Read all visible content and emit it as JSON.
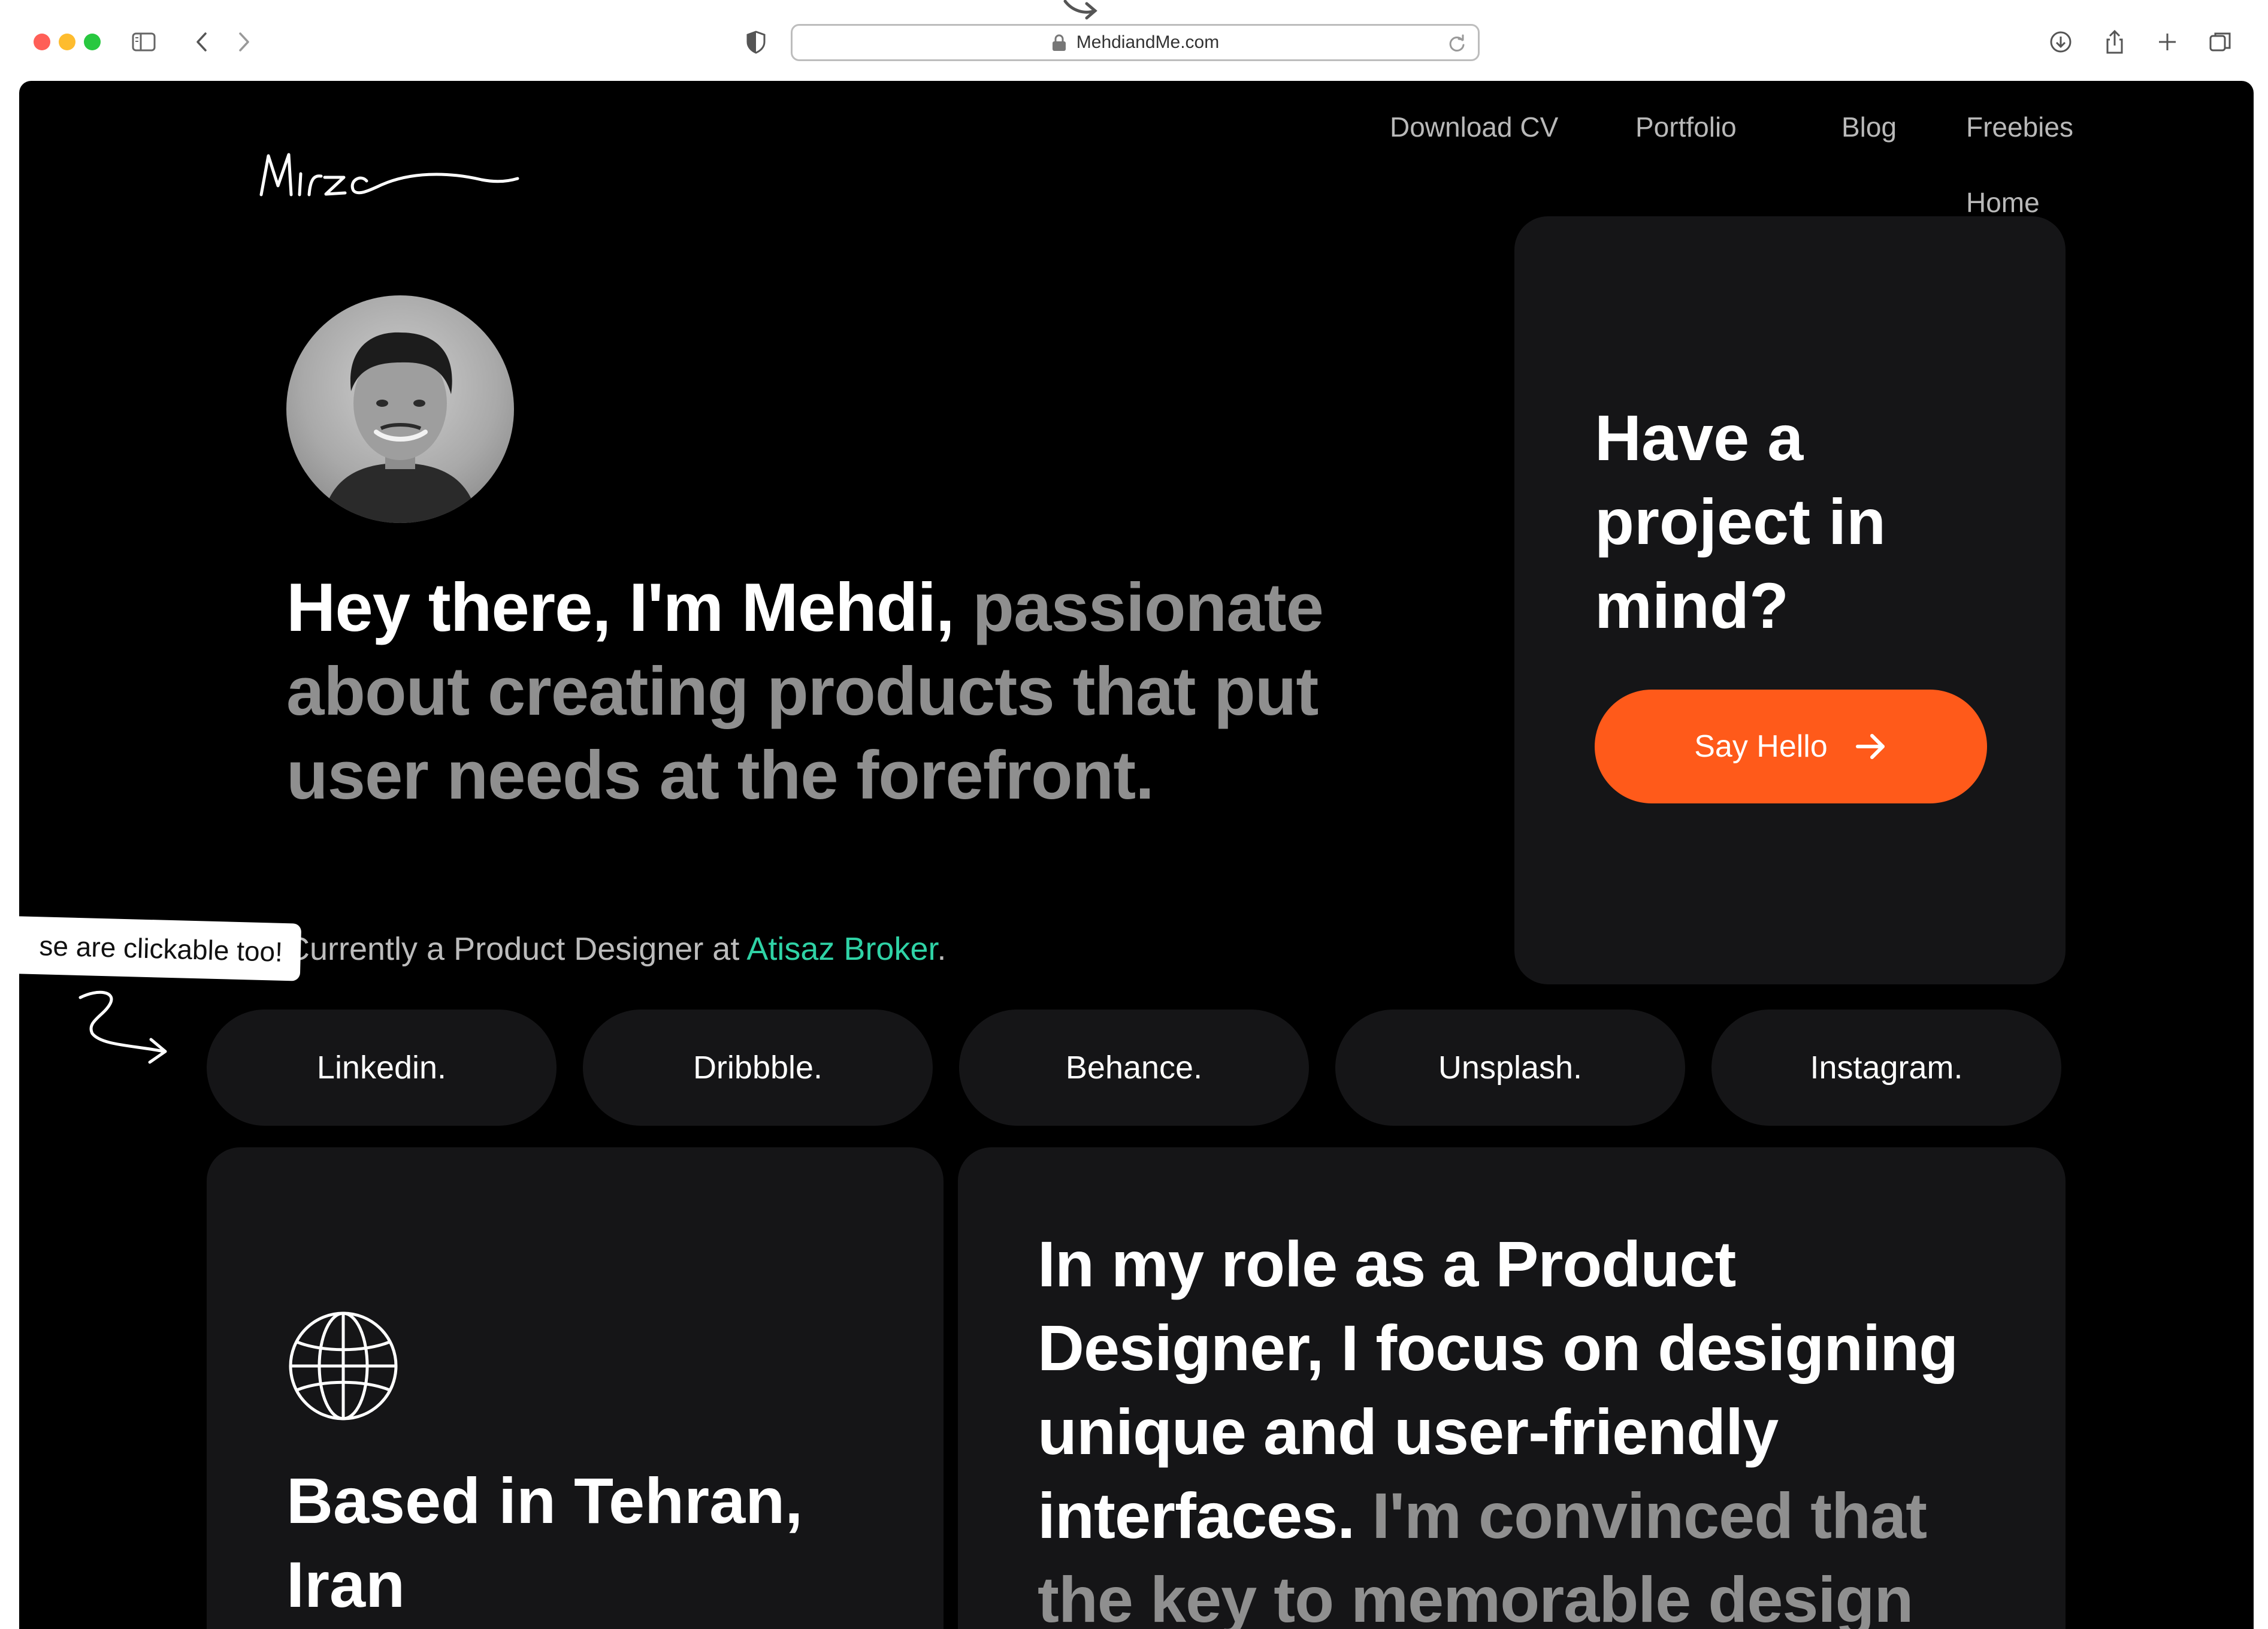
{
  "browser": {
    "url": "MehdiandMe.com"
  },
  "nav": {
    "items": [
      {
        "label": "Download CV"
      },
      {
        "label": "Portfolio"
      },
      {
        "label": "Blog"
      },
      {
        "label": "Freebies"
      },
      {
        "label": "Home"
      }
    ]
  },
  "hero": {
    "headline_strong": "Hey there, I'm Mehdi,",
    "headline_muted": "passionate about creating products that put user needs at the forefront.",
    "current_prefix": "Currently a Product Designer at",
    "current_company": "Atisaz Broker",
    "current_suffix": "."
  },
  "project_card": {
    "title": "Have a project in mind?",
    "button_label": "Say Hello"
  },
  "note": {
    "text": "se are clickable too!"
  },
  "socials": [
    {
      "label": "Linkedin."
    },
    {
      "label": "Dribbble."
    },
    {
      "label": "Behance."
    },
    {
      "label": "Unsplash."
    },
    {
      "label": "Instagram."
    }
  ],
  "location_card": {
    "text": "Based in Tehran, Iran",
    "icon": "globe-icon"
  },
  "role_card": {
    "text_strong": "In my role as a Product Designer, I focus on designing unique and user-friendly interfaces.",
    "text_muted": "I'm convinced that the key to memorable design"
  },
  "colors": {
    "accent": "#ff5a1a",
    "link": "#2fd3a6",
    "card_bg": "#151517",
    "page_bg": "#000000"
  }
}
